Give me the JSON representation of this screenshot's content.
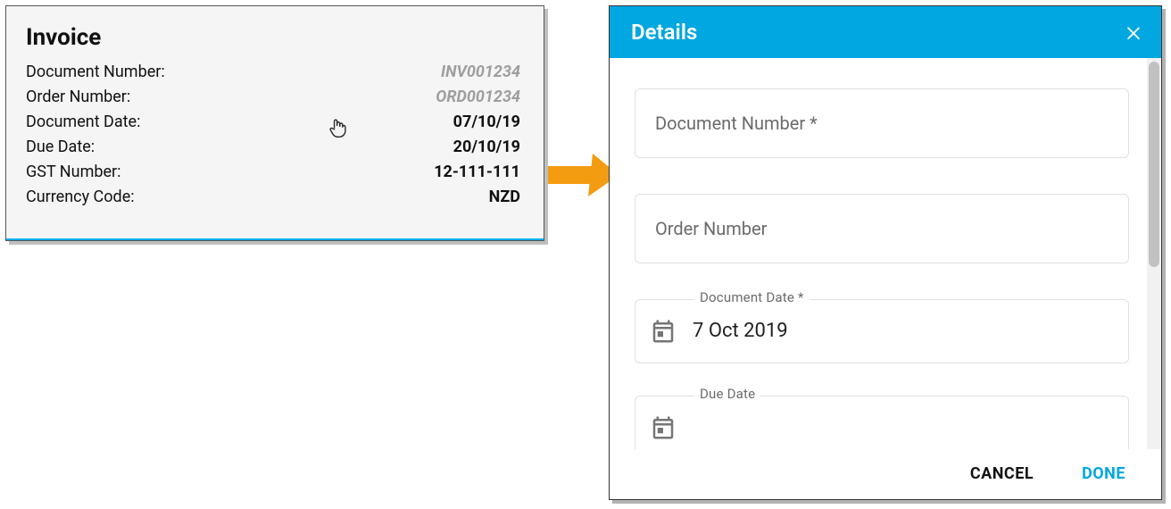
{
  "invoice": {
    "title": "Invoice",
    "rows": [
      {
        "label": "Document Number:",
        "value": "INV001234",
        "style": "placeholder"
      },
      {
        "label": "Order Number:",
        "value": "ORD001234",
        "style": "placeholder"
      },
      {
        "label": "Document Date:",
        "value": "07/10/19",
        "style": "bold"
      },
      {
        "label": "Due Date:",
        "value": "20/10/19",
        "style": "bold"
      },
      {
        "label": "GST Number:",
        "value": "12-111-111",
        "style": "bold"
      },
      {
        "label": "Currency Code:",
        "value": "NZD",
        "style": "bold"
      }
    ]
  },
  "dialog": {
    "title": "Details",
    "fields": {
      "documentNumber": {
        "label": "Document Number *",
        "value": ""
      },
      "orderNumber": {
        "label": "Order Number",
        "value": ""
      },
      "documentDate": {
        "label": "Document Date *",
        "value": "7 Oct 2019"
      },
      "dueDate": {
        "label": "Due Date",
        "value": ""
      }
    },
    "buttons": {
      "cancel": "CANCEL",
      "done": "DONE"
    }
  }
}
